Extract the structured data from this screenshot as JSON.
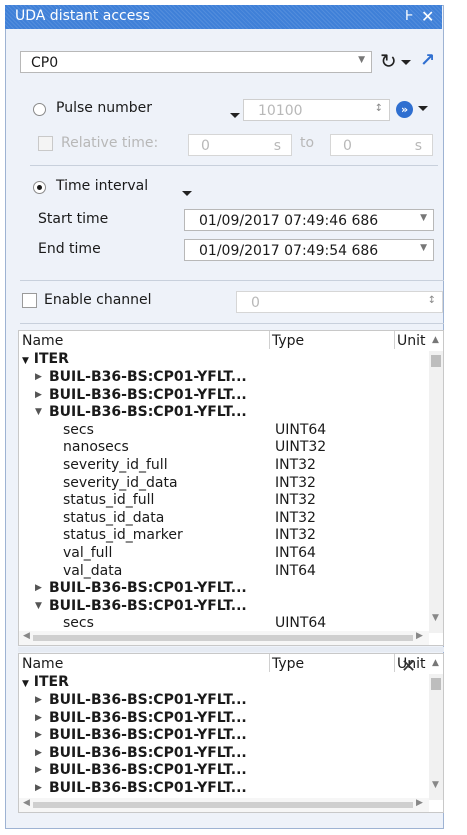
{
  "window": {
    "title": "UDA distant access",
    "pin_icon": "pin-icon",
    "close_icon": "close-icon"
  },
  "source_combo": {
    "value": "CP0"
  },
  "pulse": {
    "label": "Pulse number",
    "value": "10100",
    "relative_label": "Relative time:",
    "from_value": "0",
    "from_unit": "s",
    "to_label": "to",
    "to_value": "0",
    "to_unit": "s"
  },
  "interval": {
    "label": "Time interval",
    "start_label": "Start time",
    "start_value": "01/09/2017 07:49:46 686",
    "end_label": "End time",
    "end_value": "01/09/2017 07:49:54 686"
  },
  "channel": {
    "label": "Enable channel",
    "value": "0"
  },
  "tree1": {
    "headers": {
      "name": "Name",
      "type": "Type",
      "unit": "Unit"
    },
    "root": "ITER",
    "rows": [
      {
        "name": "BUIL-B36-BS:CP01-YFLT...",
        "type": "",
        "level": 1,
        "expander": "collapsed"
      },
      {
        "name": "BUIL-B36-BS:CP01-YFLT...",
        "type": "",
        "level": 1,
        "expander": "collapsed"
      },
      {
        "name": "BUIL-B36-BS:CP01-YFLT...",
        "type": "",
        "level": 1,
        "expander": "expanded"
      },
      {
        "name": "secs",
        "type": "UINT64",
        "level": 2,
        "expander": "none"
      },
      {
        "name": "nanosecs",
        "type": "UINT32",
        "level": 2,
        "expander": "none"
      },
      {
        "name": "severity_id_full",
        "type": "INT32",
        "level": 2,
        "expander": "none"
      },
      {
        "name": "severity_id_data",
        "type": "INT32",
        "level": 2,
        "expander": "none"
      },
      {
        "name": "status_id_full",
        "type": "INT32",
        "level": 2,
        "expander": "none"
      },
      {
        "name": "status_id_data",
        "type": "INT32",
        "level": 2,
        "expander": "none"
      },
      {
        "name": "status_id_marker",
        "type": "INT32",
        "level": 2,
        "expander": "none"
      },
      {
        "name": "val_full",
        "type": "INT64",
        "level": 2,
        "expander": "none"
      },
      {
        "name": "val_data",
        "type": "INT64",
        "level": 2,
        "expander": "none"
      },
      {
        "name": "BUIL-B36-BS:CP01-YFLT...",
        "type": "",
        "level": 1,
        "expander": "collapsed"
      },
      {
        "name": "BUIL-B36-BS:CP01-YFLT...",
        "type": "",
        "level": 1,
        "expander": "expanded"
      },
      {
        "name": "secs",
        "type": "UINT64",
        "level": 2,
        "expander": "none"
      }
    ]
  },
  "tree2": {
    "headers": {
      "name": "Name",
      "type": "Type",
      "unit": "Unit"
    },
    "root": "ITER",
    "rows": [
      {
        "name": "BUIL-B36-BS:CP01-YFLT...",
        "type": "",
        "level": 1,
        "expander": "collapsed"
      },
      {
        "name": "BUIL-B36-BS:CP01-YFLT...",
        "type": "",
        "level": 1,
        "expander": "collapsed"
      },
      {
        "name": "BUIL-B36-BS:CP01-YFLT...",
        "type": "",
        "level": 1,
        "expander": "collapsed"
      },
      {
        "name": "BUIL-B36-BS:CP01-YFLT...",
        "type": "",
        "level": 1,
        "expander": "collapsed"
      },
      {
        "name": "BUIL-B36-BS:CP01-YFLT...",
        "type": "",
        "level": 1,
        "expander": "collapsed"
      },
      {
        "name": "BUIL-B36-BS:CP01-YFLT...",
        "type": "",
        "level": 1,
        "expander": "collapsed"
      }
    ]
  },
  "colors": {
    "titlebar": "#3f80d8",
    "panel": "#eef2f9",
    "accent": "#2f6fd0"
  }
}
